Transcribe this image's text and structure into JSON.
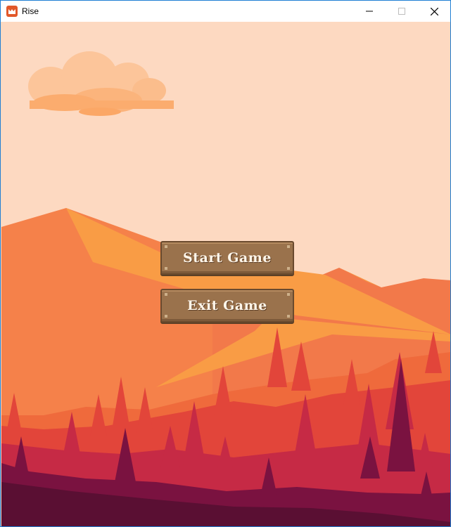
{
  "window": {
    "title": "Rise",
    "icon": "monogame-icon",
    "controls": [
      "minimize-icon",
      "maximize-icon",
      "close-icon"
    ]
  },
  "menu": {
    "start_label": "Start Game",
    "exit_label": "Exit Game"
  },
  "colors": {
    "sky": "#fdd9c1",
    "cloud": "#fcb47f",
    "mountain_far": "#f5814a",
    "mountain_highlight": "#f99c45",
    "hills_mid": "#ef6a3c",
    "hills_red": "#e2453a",
    "forest_crimson": "#c62a45",
    "ground_plum": "#5a0f33",
    "button_wood": "#9a724c"
  }
}
